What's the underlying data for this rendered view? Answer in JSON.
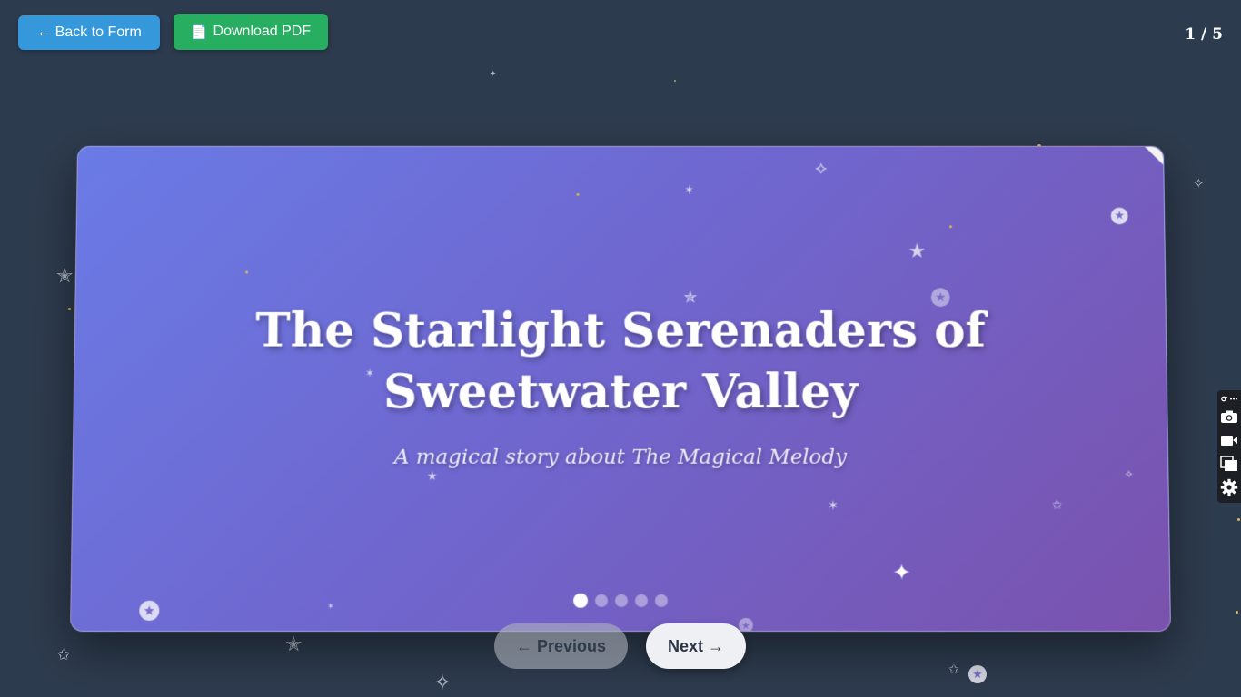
{
  "toolbar": {
    "back_label": "← Back to Form",
    "pdf_label": "Download PDF",
    "pdf_icon": "document-icon"
  },
  "page_counter": "1 / 5",
  "story": {
    "title": "The Starlight Serenaders of Sweetwater Valley",
    "subtitle": "A magical story about The Magical Melody"
  },
  "pagination": {
    "total_pages": 5,
    "current_page": 1
  },
  "navigation": {
    "previous_label": "← Previous",
    "next_label": "Next →"
  },
  "side_tools": [
    "link-icon",
    "camera-icon",
    "video-icon",
    "copy-icon",
    "settings-icon"
  ],
  "colors": {
    "background": "#2d3b4e",
    "back_button": "#3498db",
    "pdf_button": "#27ae60",
    "card_gradient_start": "#6a7be6",
    "card_gradient_end": "#7a52ad"
  }
}
